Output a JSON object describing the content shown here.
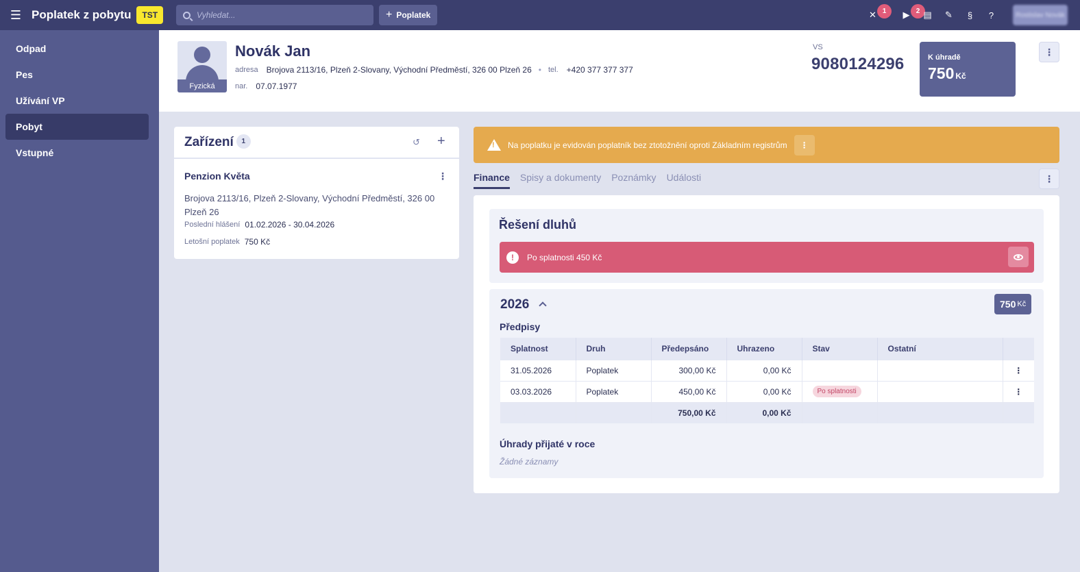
{
  "app": {
    "title": "Poplatek z pobytu",
    "env": "TST",
    "search_placeholder": "Vyhledat...",
    "add_label": "Poplatek",
    "pin_count": "1",
    "play_count": "2",
    "paragraph": "§",
    "user": "Rostislav Novák"
  },
  "sidebar": {
    "items": [
      {
        "label": "Odpad"
      },
      {
        "label": "Pes"
      },
      {
        "label": "Užívání VP"
      },
      {
        "label": "Pobyt"
      },
      {
        "label": "Vstupné"
      }
    ],
    "active": "Pobyt"
  },
  "person": {
    "name": "Novák Jan",
    "type": "Fyzická",
    "address_label": "adresa",
    "address": "Brojova 2113/16, Plzeň 2-Slovany, Východní Předměstí, 326 00 Plzeň 26",
    "tel_label": "tel.",
    "tel": "+420 377 377 377",
    "birth_label": "nar.",
    "birth": "07.07.1977",
    "vs_label": "VS",
    "vs": "9080124296",
    "due_label": "K úhradě",
    "due_amount": "750",
    "due_currency": "Kč"
  },
  "zarizeni": {
    "title": "Zařízení",
    "count": "1",
    "facility": {
      "name": "Penzion Květa",
      "address": "Brojova 2113/16, Plzeň 2-Slovany, Východní Předměstí, 326 00 Plzeň 26",
      "last_report_label": "Poslední hlášení",
      "last_report": "01.02.2026 - 30.04.2026",
      "fee_label": "Letošní poplatek",
      "fee": "750 Kč"
    }
  },
  "warning": {
    "text": "Na poplatku je evidován poplatník bez ztotožnění oproti Základním registrům"
  },
  "tabs": [
    {
      "label": "Finance",
      "active": true
    },
    {
      "label": "Spisy a dokumenty"
    },
    {
      "label": "Poznámky"
    },
    {
      "label": "Události"
    }
  ],
  "finance": {
    "debt_title": "Řešení dluhů",
    "overdue_text": "Po splatnosti 450 Kč",
    "year": "2026",
    "year_total": "750",
    "year_total_currency": "Kč",
    "predpisy_title": "Předpisy",
    "table": {
      "headers": [
        "Splatnost",
        "Druh",
        "Předepsáno",
        "Uhrazeno",
        "Stav",
        "Ostatní"
      ],
      "rows": [
        {
          "splatnost": "31.05.2026",
          "druh": "Poplatek",
          "predepsano": "300,00 Kč",
          "uhrazeno": "0,00 Kč",
          "stav": ""
        },
        {
          "splatnost": "03.03.2026",
          "druh": "Poplatek",
          "predepsano": "450,00 Kč",
          "uhrazeno": "0,00 Kč",
          "stav": "Po splatnosti"
        }
      ],
      "total_predepsano": "750,00 Kč",
      "total_uhrazeno": "0,00 Kč"
    },
    "payments_title": "Úhrady přijaté v roce",
    "payments_empty": "Žádné záznamy"
  },
  "colors": {
    "topbar": "#3b3f6e",
    "sidebar": "#555b8e",
    "warning": "#e5aa4e",
    "danger": "#d75b76",
    "env_badge": "#f8e72e"
  }
}
